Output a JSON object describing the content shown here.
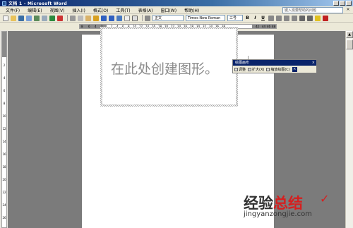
{
  "window": {
    "title": "文档 1 - Microsoft Word"
  },
  "menu": {
    "items": [
      "文件(F)",
      "编辑(E)",
      "视图(V)",
      "插入(I)",
      "格式(O)",
      "工具(T)",
      "表格(A)",
      "窗口(W)",
      "帮助(H)"
    ],
    "help_placeholder": "键入需要帮助的问题",
    "close_glyph": "×"
  },
  "toolbar": {
    "style": "正文",
    "font": "Times New Roman",
    "size": "三号",
    "bold": "B",
    "italic": "I",
    "underline": "U"
  },
  "ruler": {
    "ticks": [
      "8",
      "6",
      "4",
      "2",
      "2",
      "4",
      "6",
      "8",
      "10",
      "12",
      "14",
      "16",
      "18",
      "20",
      "22",
      "24",
      "26",
      "28",
      "30",
      "32",
      "34",
      "36",
      "38",
      "42",
      "44",
      "46",
      "48"
    ],
    "vticks": [
      "2",
      "4",
      "6",
      "8",
      "10",
      "12",
      "14",
      "16",
      "18",
      "20",
      "22",
      "24",
      "26"
    ]
  },
  "canvas": {
    "placeholder": "在此处创建图形。"
  },
  "canvas_toolbar": {
    "title": "绘图画布",
    "close_glyph": "×",
    "buttons": [
      "调整",
      "扩大(X)",
      "缩放绘图(C)"
    ]
  },
  "watermark": {
    "part1": "经验",
    "part2": "总结",
    "check": "✓",
    "url": "jingyanzongjie.com"
  },
  "colors": {
    "titlebar": "#0a246a",
    "canvas_text": "#8c8c8c",
    "watermark_red": "#d61f1f"
  }
}
